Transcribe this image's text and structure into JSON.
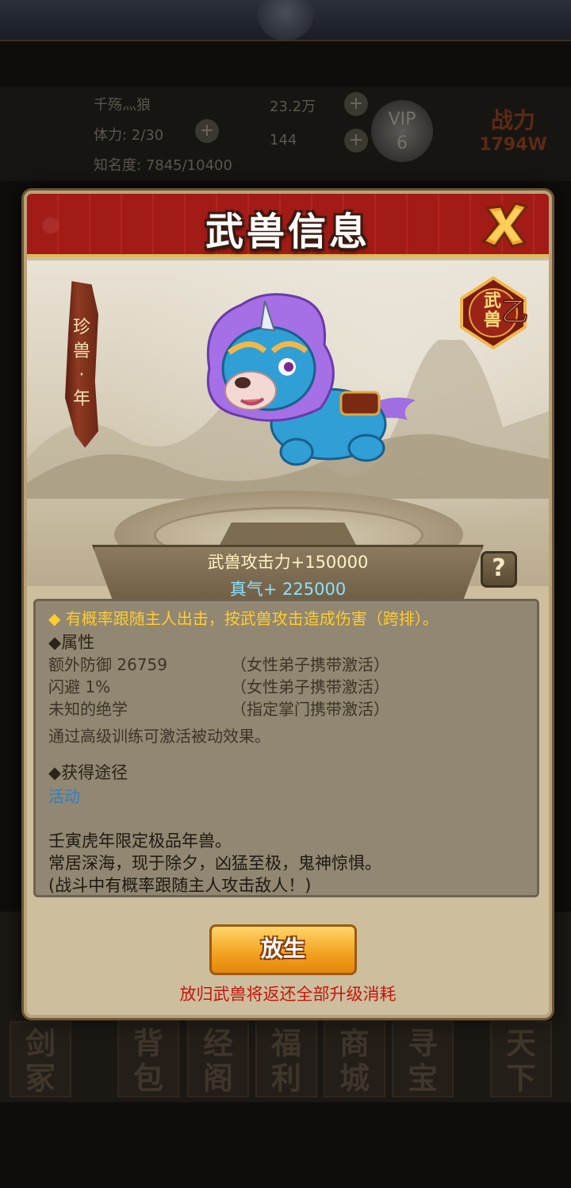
{
  "background": {
    "player_name": "千殇灬狼",
    "stamina": "体力: 2/30",
    "fame": "知名度: 7845/10400",
    "silver": "23.2万",
    "gold": "144",
    "vip_label": "VIP",
    "vip_level": "6",
    "power_label": "战力",
    "power_value": "1794W",
    "nav_items": [
      "剑\n冢",
      "背\n包",
      "经\n阁",
      "福\n利",
      "商\n城",
      "寻\n宝",
      "天\n下"
    ]
  },
  "modal": {
    "title": "武兽信息",
    "close_icon": "close-x-icon",
    "beast_name_chars": [
      "珍",
      "兽",
      "·",
      "年"
    ],
    "grade_badge": {
      "line1": "武",
      "line2": "兽",
      "grade": "乙"
    },
    "attack_bonus": "武兽攻击力+150000",
    "qi_bonus": "真气+ 225000",
    "help_label": "?",
    "ability": "◆ 有概率跟随主人出击，按武兽攻击造成伤害（跨排）。",
    "attributes_heading": "◆属性",
    "attributes": [
      {
        "name": "额外防御  26759",
        "condition": "（女性弟子携带激活）"
      },
      {
        "name": "闪避  1%",
        "condition": "（女性弟子携带激活）"
      },
      {
        "name": "未知的绝学",
        "condition": "（指定掌门携带激活）"
      }
    ],
    "passive_note": "通过高级训练可激活被动效果。",
    "source_heading": "◆获得途径",
    "source_link": "活动",
    "lore": [
      "壬寅虎年限定极品年兽。",
      "常居深海，现于除夕，凶猛至极，鬼神惊惧。",
      "(战斗中有概率跟随主人攻击敌人！)"
    ],
    "release_button": "放生",
    "release_note": "放归武兽将返还全部升级消耗"
  },
  "colors": {
    "header_red": "#a81e1a",
    "ability_orange": "#ffcc2e",
    "qi_cyan": "#8be0ff",
    "link_blue": "#2f7fc3",
    "warning_red": "#c4160d"
  }
}
